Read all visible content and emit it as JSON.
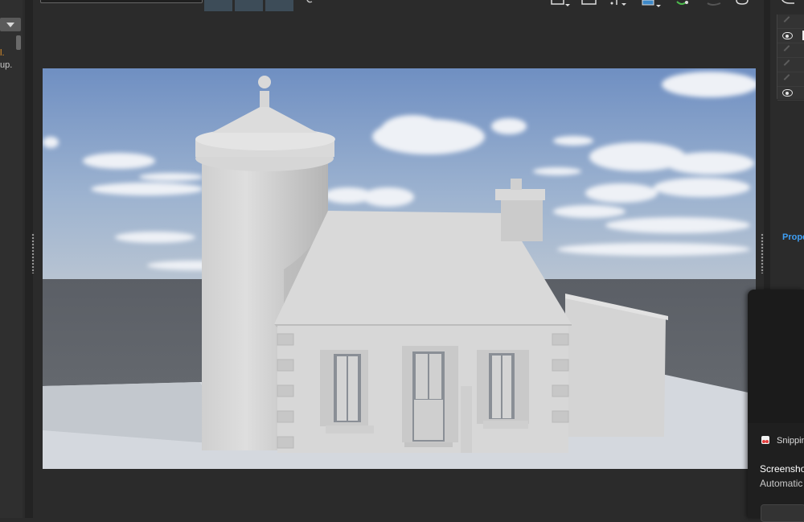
{
  "left_panel": {
    "text_line_1": "l.",
    "text_line_2": "up."
  },
  "right_panel": {
    "properties_tab_label": "Prope",
    "layers": [
      {
        "icon": "pencil-icon",
        "visible": false
      },
      {
        "icon": "eye-icon",
        "visible": true
      },
      {
        "icon": "pencil-icon",
        "visible": false
      },
      {
        "icon": "pencil-icon",
        "visible": false
      },
      {
        "icon": "pencil-icon",
        "visible": false
      },
      {
        "icon": "eye-icon",
        "visible": true
      }
    ]
  },
  "notification": {
    "app_name": "Snippin",
    "title": "Screensho",
    "body": "Automatic"
  },
  "colors": {
    "accent": "#3e9ff5",
    "warning_text": "#e0902a"
  }
}
